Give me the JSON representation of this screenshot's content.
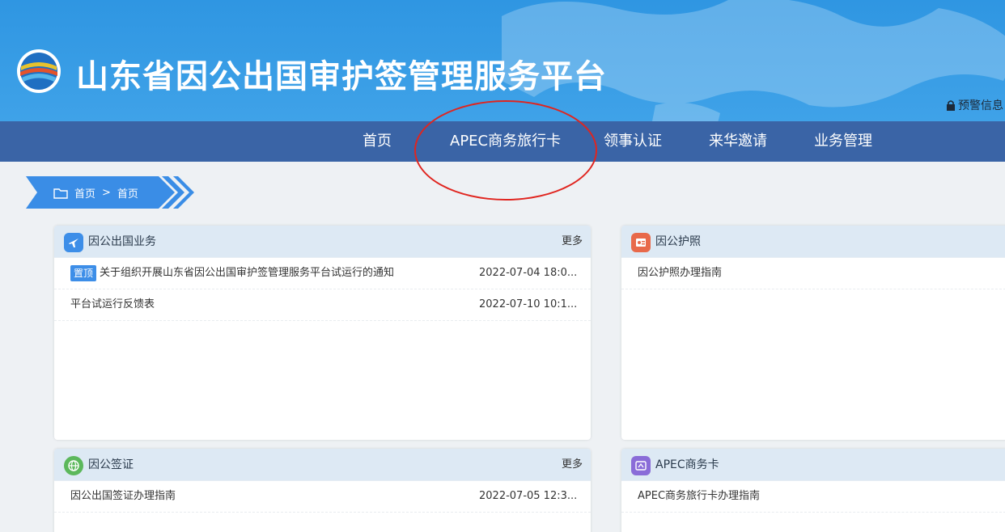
{
  "header": {
    "site_title": "山东省因公出国审护签管理服务平台",
    "alert_label": "预警信息"
  },
  "nav": {
    "items": [
      {
        "label": "首页"
      },
      {
        "label": "APEC商务旅行卡"
      },
      {
        "label": "领事认证"
      },
      {
        "label": "来华邀请"
      },
      {
        "label": "业务管理"
      }
    ]
  },
  "breadcrumb": {
    "home": "首页",
    "separator": ">",
    "current": "首页"
  },
  "cards": {
    "business": {
      "title": "因公出国业务",
      "more": "更多",
      "rows": [
        {
          "badge": "置顶",
          "title": "关于组织开展山东省因公出国审护签管理服务平台试运行的通知",
          "date": "2022-07-04 18:0..."
        },
        {
          "title": "平台试运行反馈表",
          "date": "2022-07-10 10:1..."
        }
      ]
    },
    "passport": {
      "title": "因公护照",
      "rows": [
        {
          "title": "因公护照办理指南"
        }
      ]
    },
    "visa": {
      "title": "因公签证",
      "more": "更多",
      "rows": [
        {
          "title": "因公出国签证办理指南",
          "date": "2022-07-05 12:3..."
        }
      ]
    },
    "apec": {
      "title": "APEC商务卡",
      "rows": [
        {
          "title": "APEC商务旅行卡办理指南"
        }
      ]
    }
  },
  "colors": {
    "header_blue": "#2f96e2",
    "nav_blue": "#3a64a6",
    "annotation_red": "#e0251f"
  }
}
